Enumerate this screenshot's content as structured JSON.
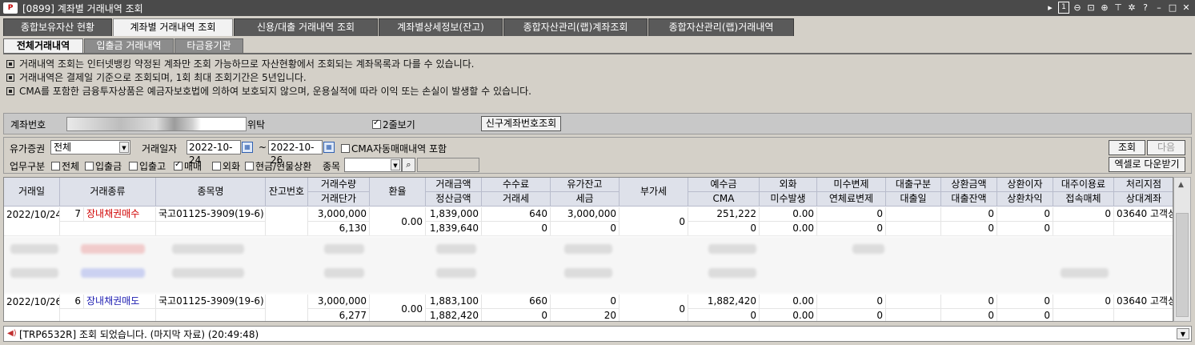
{
  "window": {
    "logo": "P",
    "title": "[0899] 계좌별 거래내역 조회",
    "icon_page": "1"
  },
  "main_tabs": [
    {
      "label": "종합보유자산 현황",
      "active": false
    },
    {
      "label": "계좌별 거래내역 조회",
      "active": true
    },
    {
      "label": "신용/대출 거래내역 조회",
      "active": false
    },
    {
      "label": "계좌별상세정보(잔고)",
      "active": false
    },
    {
      "label": "종합자산관리(랩)계좌조회",
      "active": false
    },
    {
      "label": "종합자산관리(랩)거래내역",
      "active": false
    }
  ],
  "sub_tabs": [
    {
      "label": "전체거래내역",
      "active": true
    },
    {
      "label": "입출금 거래내역",
      "active": false
    },
    {
      "label": "타금융기관",
      "active": false
    }
  ],
  "notes": [
    "거래내역 조회는 인터넷뱅킹 약정된 계좌만 조회 가능하므로 자산현황에서 조회되는 계좌목록과 다를 수 있습니다.",
    "거래내역은 결제일 기준으로 조회되며, 1회 최대 조회기간은 5년입니다.",
    "CMA를 포함한 금융투자상품은 예금자보호법에 의하여 보호되지 않으며, 운용실적에 따라 이익 또는 손실이 발생할 수 있습니다."
  ],
  "account": {
    "label": "계좌번호",
    "type": "위탁",
    "two_row_label": "2줄보기",
    "two_row_checked": true,
    "lookup_button": "신구계좌번호조회"
  },
  "filters": {
    "security_label": "유가증권",
    "security_value": "전체",
    "date_label": "거래일자",
    "date_from": "2022-10-24",
    "date_sep": "~",
    "date_to": "2022-10-26",
    "cma_label": "CMA자동매매내역 포함",
    "biz_label": "업무구분",
    "checks": [
      {
        "label": "전체",
        "checked": false
      },
      {
        "label": "입출금",
        "checked": false
      },
      {
        "label": "입출고",
        "checked": false
      },
      {
        "label": "매매",
        "checked": true
      },
      {
        "label": "외화",
        "checked": false
      },
      {
        "label": "현금/현물상환",
        "checked": false
      }
    ],
    "item_label": "종목",
    "search_button": "조회",
    "next_button": "다음",
    "excel_button": "엑셀로 다운받기"
  },
  "table": {
    "headers": [
      [
        "거래일",
        ""
      ],
      [
        "거래종류",
        ""
      ],
      [
        "종목명",
        ""
      ],
      [
        "잔고번호",
        ""
      ],
      [
        "거래수량",
        "거래단가"
      ],
      [
        "환율",
        ""
      ],
      [
        "거래금액",
        "정산금액"
      ],
      [
        "수수료",
        "거래세"
      ],
      [
        "유가잔고",
        "세금"
      ],
      [
        "부가세",
        ""
      ],
      [
        "예수금",
        "CMA"
      ],
      [
        "외화",
        "미수발생"
      ],
      [
        "미수변제",
        "연체료변제"
      ],
      [
        "대출구분",
        "대출일"
      ],
      [
        "상환금액",
        "대출잔액"
      ],
      [
        "상환이자",
        "상환차익"
      ],
      [
        "대주이용료",
        "접속매체"
      ],
      [
        "처리지점",
        "상대계좌"
      ]
    ],
    "rows": [
      {
        "date": "2022/10/24",
        "seq": "7",
        "kind": "장내채권매수",
        "kind_color": "red",
        "name": "국고01125-3909(19-6)",
        "balno": "",
        "qty": "3,000,000",
        "price": "6,130",
        "fx": "0.00",
        "amount": "1,839,000",
        "settle": "1,839,640",
        "fee": "640",
        "tax_trade": "0",
        "sec_bal": "3,000,000",
        "tax": "0",
        "vat": "0",
        "deposit": "251,222",
        "cma": "0",
        "fx2": "0.00",
        "unpaid": "0.00",
        "repay": "0",
        "overdue": "0",
        "loan_type": "",
        "loan_date": "",
        "redeem": "0",
        "loan_bal": "0",
        "redeem_int": "0",
        "redeem_gain": "0",
        "lend_fee": "0",
        "media": "",
        "branch": "03640 고객상",
        "counter": ""
      },
      {
        "date": "2022/10/26",
        "seq": "6",
        "kind": "장내채권매도",
        "kind_color": "blue",
        "name": "국고01125-3909(19-6)",
        "balno": "",
        "qty": "3,000,000",
        "price": "6,277",
        "fx": "0.00",
        "amount": "1,883,100",
        "settle": "1,882,420",
        "fee": "660",
        "tax_trade": "0",
        "sec_bal": "0",
        "tax": "20",
        "vat": "0",
        "deposit": "1,882,420",
        "cma": "0",
        "fx2": "0.00",
        "unpaid": "0.00",
        "repay": "0",
        "overdue": "0",
        "loan_type": "",
        "loan_date": "",
        "redeem": "0",
        "loan_bal": "0",
        "redeem_int": "0",
        "redeem_gain": "0",
        "lend_fee": "0",
        "media": "",
        "branch": "03640 고객상",
        "counter": ""
      }
    ]
  },
  "status": {
    "message": "[TRP6532R] 조회 되었습니다. (마지막 자료) (20:49:48)"
  },
  "colors": {
    "active_tab": "#f2f2f2",
    "inactive_tab": "#5a5a5a",
    "buy": "#d00000",
    "sell": "#1a1ab0",
    "header": "#dee1ea"
  }
}
